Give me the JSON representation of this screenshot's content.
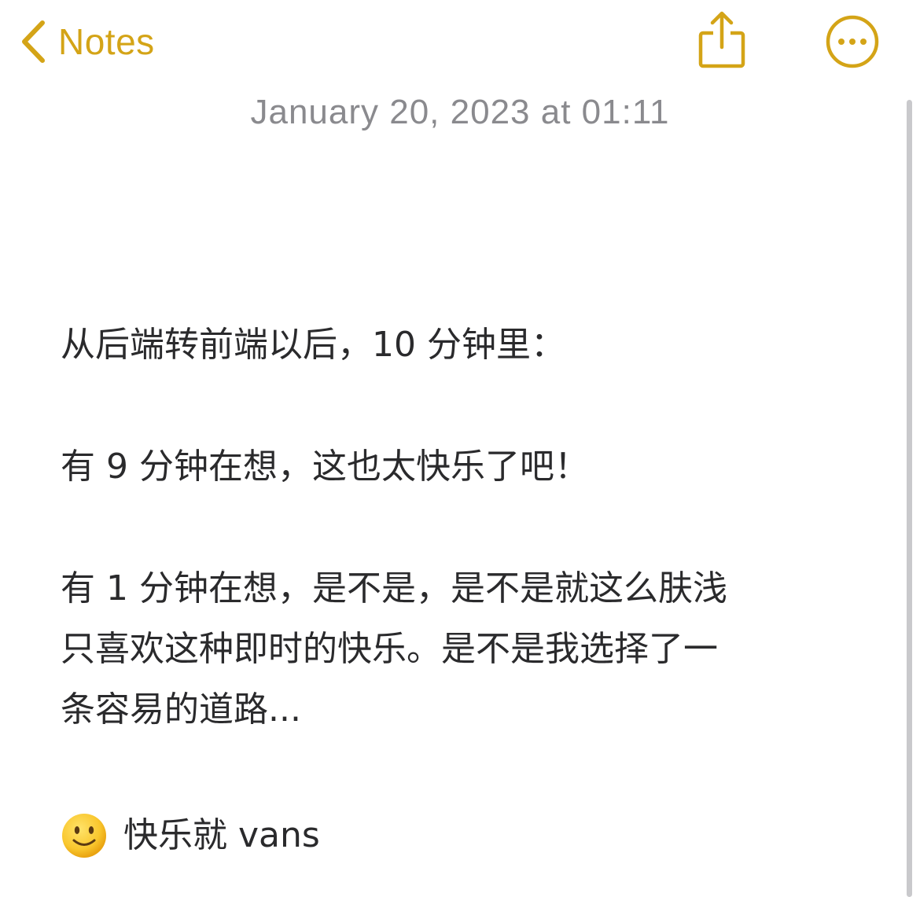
{
  "nav": {
    "back_label": "Notes",
    "back_icon": "chevron-left-icon",
    "share_icon": "share-icon",
    "more_icon": "ellipsis-circle-icon",
    "accent_color": "#D4A417"
  },
  "note": {
    "timestamp": "January 20, 2023 at 01:11",
    "paragraphs": [
      [
        "从后端转前端以后，10 分钟里："
      ],
      [
        "有 9 分钟在想，这也太快乐了吧！"
      ],
      [
        "有 1 分钟在想，是不是，是不是就这么肤浅",
        "只喜欢这种即时的快乐。是不是我选择了一",
        "条容易的道路..."
      ]
    ],
    "closing_emoji": "slightly-smiling-face-emoji",
    "closing_text": "快乐就 vans"
  }
}
